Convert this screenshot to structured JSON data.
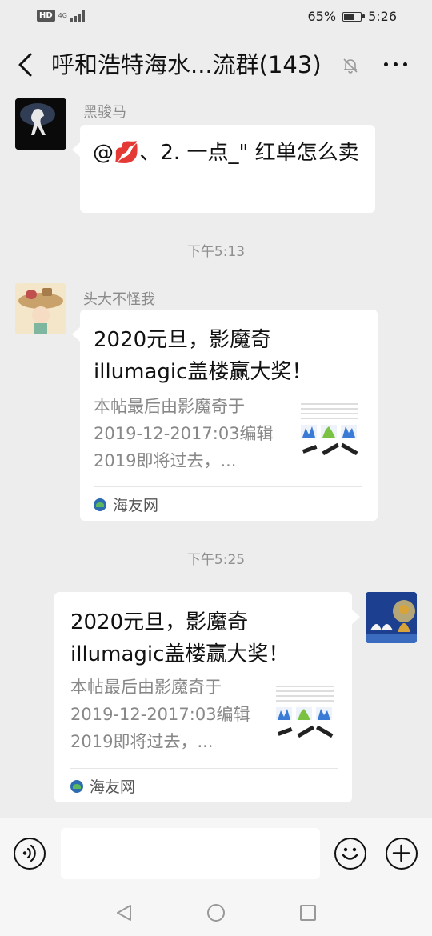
{
  "status_bar": {
    "hd_badge": "HD",
    "network": "4G",
    "battery": "65%",
    "battery_level": 0.65,
    "time": "5:26"
  },
  "header": {
    "title": "呼和浩特海水...流群(143)"
  },
  "messages": [
    {
      "type": "text",
      "side": "left",
      "sender": "黑骏马",
      "text_prefix": "@",
      "text_emoji": "💋",
      "text_suffix": "、2. 一点_\" 红单怎么卖"
    },
    {
      "type": "time",
      "text": "下午5:13"
    },
    {
      "type": "link",
      "side": "left",
      "sender": "头大不怪我",
      "title": "2020元旦，影魔奇illumagic盖楼赢大奖！",
      "desc": "本帖最后由影魔奇于2019-12-2017:03编辑2019即将过去，...",
      "source": "海友网"
    },
    {
      "type": "time",
      "text": "下午5:25"
    },
    {
      "type": "link",
      "side": "right",
      "title": "2020元旦，影魔奇illumagic盖楼赢大奖！",
      "desc": "本帖最后由影魔奇于2019-12-2017:03编辑2019即将过去，...",
      "source": "海友网"
    }
  ],
  "input_bar": {
    "voice_icon": "voice-icon",
    "emoji_icon": "emoji-icon",
    "add_icon": "plus-icon"
  }
}
